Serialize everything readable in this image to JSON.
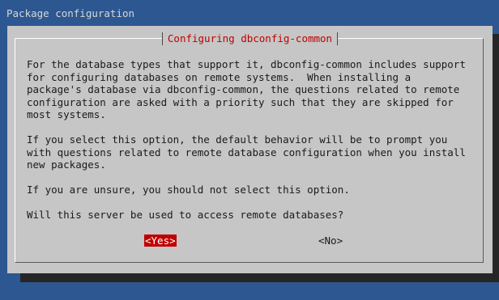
{
  "backtitle": "Package configuration",
  "dialog": {
    "title": "Configuring dbconfig-common",
    "paragraphs": [
      "For the database types that support it, dbconfig-common includes support\nfor configuring databases on remote systems.  When installing a\npackage's database via dbconfig-common, the questions related to remote\nconfiguration are asked with a priority such that they are skipped for\nmost systems.",
      "If you select this option, the default behavior will be to prompt you\nwith questions related to remote database configuration when you install\nnew packages.",
      "If you are unsure, you should not select this option.",
      "Will this server be used to access remote databases?"
    ],
    "buttons": {
      "yes": "<Yes>",
      "no": "<No>"
    }
  },
  "colors": {
    "background": "#2c5791",
    "dialog": "#c6c6c6",
    "accent": "#c00000"
  }
}
